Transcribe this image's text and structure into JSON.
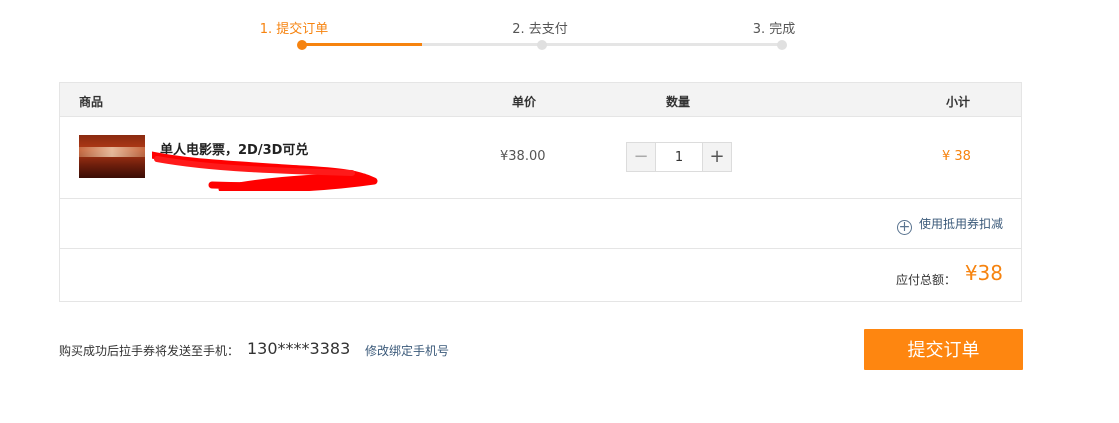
{
  "steps": [
    {
      "label": "1. 提交订单",
      "active": true
    },
    {
      "label": "2. 去支付",
      "active": false
    },
    {
      "label": "3. 完成",
      "active": false
    }
  ],
  "table": {
    "headers": {
      "product": "商品",
      "unit_price": "单价",
      "quantity": "数量",
      "subtotal": "小计"
    },
    "item": {
      "name": "单人电影票，2D/3D可兑",
      "unit_price": "¥38.00",
      "quantity": "1",
      "minus": "−",
      "plus": "+",
      "subtotal": "¥ 38"
    },
    "coupon": {
      "icon": "+",
      "label": "使用抵用券扣减"
    },
    "total": {
      "label": "应付总额：",
      "value": "¥38"
    }
  },
  "footer": {
    "notice": "购买成功后拉手券将发送至手机：",
    "phone": "130****3383",
    "change_phone": "修改绑定手机号",
    "submit": "提交订单"
  },
  "colors": {
    "accent": "#f6830f",
    "button": "#fe8610",
    "link": "#3b5a7a",
    "redaction": "#ff0000"
  }
}
